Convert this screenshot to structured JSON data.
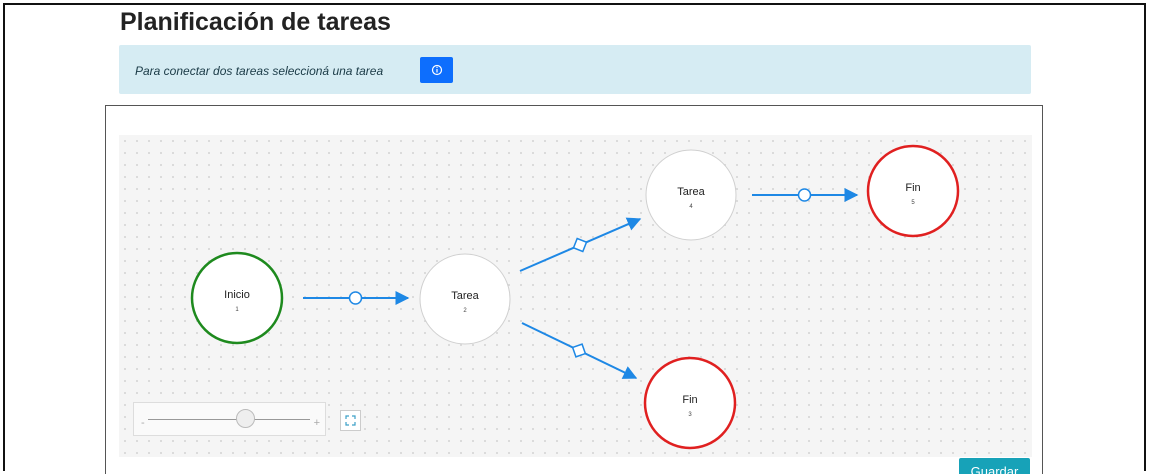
{
  "page": {
    "title": "Planificación de tareas"
  },
  "alert": {
    "text": "Para conectar dos tareas seleccioná una tarea",
    "info_icon": "info-circle-icon"
  },
  "diagram": {
    "nodes": [
      {
        "id": "1",
        "label": "Inicio",
        "type": "start",
        "color": "#1e8a1e"
      },
      {
        "id": "2",
        "label": "Tarea",
        "type": "task",
        "color": "#d0d0d0"
      },
      {
        "id": "4",
        "label": "Tarea",
        "type": "task",
        "color": "#d0d0d0"
      },
      {
        "id": "5",
        "label": "Fin",
        "type": "end",
        "color": "#e02020"
      },
      {
        "id": "3",
        "label": "Fin",
        "type": "end",
        "color": "#e02020"
      }
    ],
    "edges": [
      {
        "from": "1",
        "to": "2",
        "marker": "circle"
      },
      {
        "from": "2",
        "to": "4",
        "marker": "diamond"
      },
      {
        "from": "2",
        "to": "3",
        "marker": "diamond"
      },
      {
        "from": "4",
        "to": "5",
        "marker": "circle"
      }
    ],
    "edge_color": "#1e88e5"
  },
  "controls": {
    "zoom_minus": "-",
    "zoom_plus": "+",
    "zoom_level": 0.6,
    "fullscreen_icon": "expand-icon"
  },
  "footer": {
    "save_label": "Guardar"
  }
}
